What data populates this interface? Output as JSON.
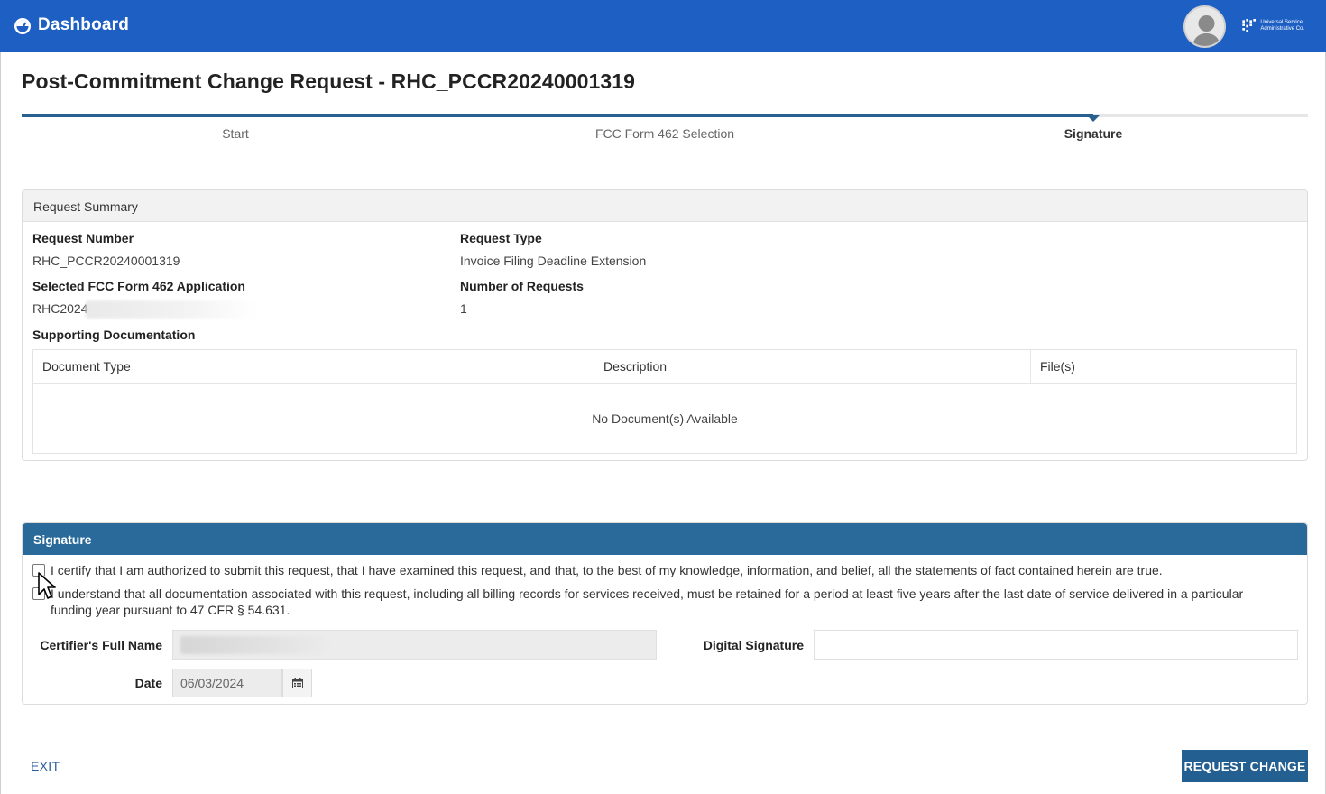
{
  "header": {
    "brand_label": "Dashboard",
    "brand_color": "#1e5fc4",
    "logo_text": "Universal Service Administrative Co."
  },
  "page": {
    "title": "Post-Commitment Change Request - RHC_PCCR20240001319"
  },
  "stepper": {
    "steps": [
      {
        "label": "Start",
        "active": false
      },
      {
        "label": "FCC Form 462 Selection",
        "active": false
      },
      {
        "label": "Signature",
        "active": true
      }
    ]
  },
  "summary": {
    "heading": "Request Summary",
    "request_number_label": "Request Number",
    "request_number": "RHC_PCCR20240001319",
    "request_type_label": "Request Type",
    "request_type": "Invoice Filing Deadline Extension",
    "application_label": "Selected FCC Form 462 Application",
    "application_value": "RHC2024",
    "num_requests_label": "Number of Requests",
    "num_requests": "1",
    "supporting_label": "Supporting Documentation",
    "doc_columns": [
      "Document Type",
      "Description",
      "File(s)"
    ],
    "doc_empty": "No Document(s) Available"
  },
  "signature": {
    "heading": "Signature",
    "heading_color": "#2a6a9b",
    "certifications": [
      {
        "text": "I certify that I am authorized to submit this request, that I have examined this request, and that, to the best of my knowledge, information, and belief, all the statements of fact contained herein are true.",
        "checked": false
      },
      {
        "text": "I understand that all documentation associated with this request, including all billing records for services received, must be retained for a period at least five years after the last date of service delivered in a particular funding year pursuant to 47 CFR § 54.631.",
        "checked": false
      }
    ],
    "name_label": "Certifier's Full Name",
    "digital_sig_label": "Digital Signature",
    "date_label": "Date",
    "date_value": "06/03/2024"
  },
  "footer": {
    "exit_label": "EXIT",
    "submit_label": "REQUEST CHANGE",
    "submit_color": "#245f92"
  }
}
